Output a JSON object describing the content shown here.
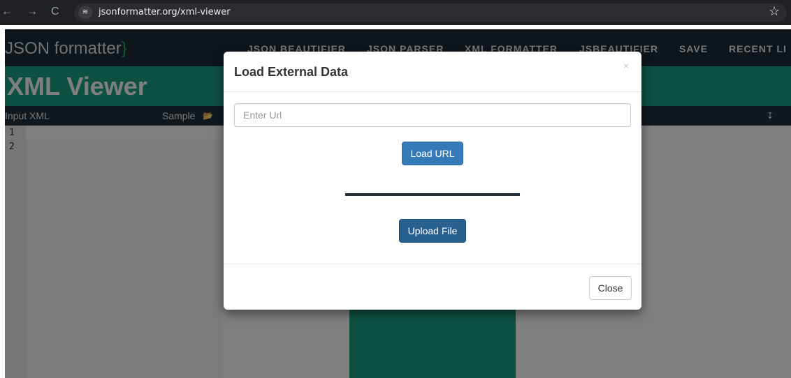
{
  "browser": {
    "back_icon": "←",
    "forward_icon": "→",
    "reload_icon": "C",
    "site_icon": "≋",
    "url": "jsonformatter.org/xml-viewer",
    "bookmark_icon": "☆"
  },
  "site": {
    "logo_main": "JSON formatter",
    "logo_brace": "}",
    "nav": [
      "JSON BEAUTIFIER",
      "JSON PARSER",
      "XML FORMATTER",
      "JSBEAUTIFIER",
      "SAVE",
      "RECENT LI"
    ],
    "page_title": "XML Viewer",
    "input_label": "Input XML",
    "sample_label": "Sample",
    "line_numbers": [
      "1",
      "2"
    ]
  },
  "modal": {
    "title": "Load External Data",
    "close_symbol": "×",
    "url_placeholder": "Enter Url",
    "load_url_label": "Load URL",
    "upload_file_label": "Upload File",
    "close_label": "Close"
  },
  "colors": {
    "nav_bg": "#1d2b36",
    "brand_green": "#1ca085",
    "primary_blue": "#337ab7",
    "upload_blue": "#286090"
  }
}
